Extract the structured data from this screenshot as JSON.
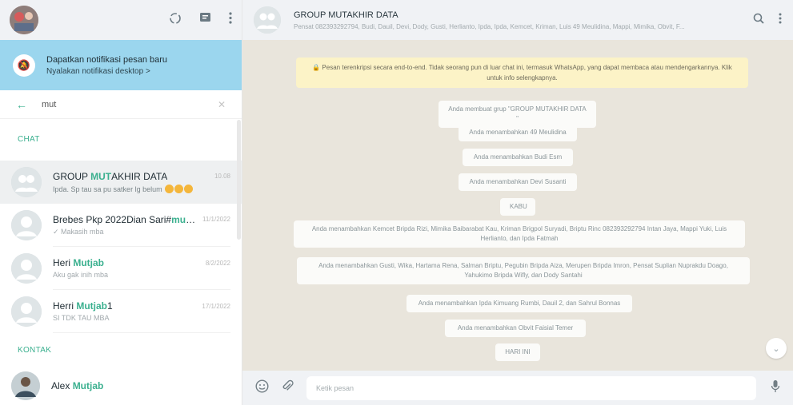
{
  "left_header": {
    "icons": [
      "status-icon",
      "new-chat-icon",
      "menu-icon"
    ]
  },
  "notification": {
    "title": "Dapatkan notifikasi pesan baru",
    "subtitle": "Nyalakan notifikasi desktop >"
  },
  "search": {
    "query": "mut"
  },
  "sections": {
    "chat": "CHAT",
    "contacts": "KONTAK"
  },
  "chats": [
    {
      "name_pre": "GROUP ",
      "name_hl": "MUT",
      "name_post": "AKHIR DATA",
      "time": "10.08",
      "message": "Ipda. Sp tau sa pu satker lg belum "
    },
    {
      "name_pre": "Brebes Pkp 2022Dian Sari#",
      "name_hl": "mutia",
      "name_post": "...",
      "time": "11/1/2022",
      "message": "✓ Makasih mba"
    },
    {
      "name_pre": "Heri ",
      "name_hl": "Mutjab",
      "name_post": "",
      "time": "8/2/2022",
      "message": "Aku gak inih mba"
    },
    {
      "name_pre": "Herri ",
      "name_hl": "Mutjab",
      "name_post": "1",
      "time": "17/1/2022",
      "message": "SI TDK TAU MBA"
    }
  ],
  "contacts": [
    {
      "name_pre": "Alex ",
      "name_hl": "Mutjab",
      "name_post": ""
    }
  ],
  "chat": {
    "title": "GROUP MUTAKHIR DATA",
    "participants": "Pensat 082393292794, Budi, Dauil, Devi, Dody, Gusti, Herlianto, Ipda, Ipda, Kemcet, Kriman, Luis 49 Meulidina, Mappi, Mimika, Obvit, F...",
    "encryption_note": "🔒 Pesan terenkripsi secara end-to-end. Tidak seorang pun di luar chat ini, termasuk WhatsApp, yang dapat membaca atau mendengarkannya. Klik untuk info selengkapnya.",
    "system_messages": [
      "Anda membuat grup \"GROUP MUTAKHIR DATA \"",
      "Anda menambahkan 49 Meulidina",
      "Anda menambahkan Budi Esm",
      "Anda menambahkan Devi Susanti",
      "KABU",
      "Anda menambahkan Kemcet Bripda Rizi, Mimika Baibarabat Kau, Kriman Brigpol Suryadi, Briptu Rinc 082393292794 Intan Jaya, Mappi Yuki, Luis Herlianto, dan Ipda Fatmah",
      "Anda menambahkan Gusti, Wika, Hartama Rena, Salman Briptu, Pegubin Bripda Aiza, Merupen Bripda Imron, Pensat Suplian Nuprakdu Doago, Yahukimo Bripda Wifly, dan Dody Santahi",
      "Anda menambahkan Ipda Kimuang Rumbi, Dauil 2, dan Sahrul Bonnas",
      "Anda menambahkan Obvit Faisial Temer",
      "HARI INI"
    ]
  },
  "composer": {
    "placeholder": "Ketik pesan"
  },
  "colors": {
    "accent": "#3bb08f",
    "notification_bg": "#9bd6ee",
    "chat_bg": "#e9e5dc",
    "encryption_bg": "#fcf3c7"
  }
}
